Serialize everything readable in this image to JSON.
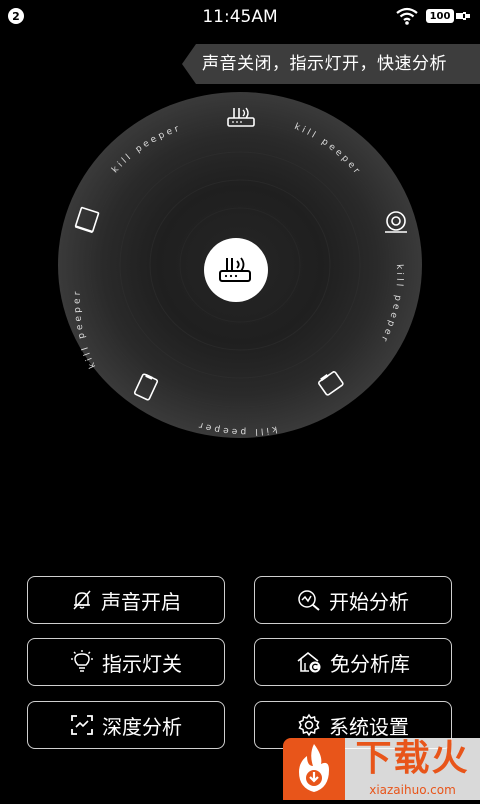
{
  "status_bar": {
    "notification_count": "2",
    "time": "11:45AM",
    "battery": "100",
    "icons": [
      "wifi-icon",
      "battery-icon",
      "charging-icon"
    ]
  },
  "banner": {
    "text": "声音关闭，指示灯开，快速分析"
  },
  "dial": {
    "ring_label": "kill peeper",
    "center_icon": "router-icon",
    "device_icons": [
      "router-icon",
      "camera-icon",
      "tablet-icon",
      "phone-icon",
      "tv-icon"
    ]
  },
  "buttons": {
    "sound": {
      "label": "声音开启",
      "icon": "bell-off-icon"
    },
    "analyze": {
      "label": "开始分析",
      "icon": "search-chart-icon"
    },
    "indicator": {
      "label": "指示灯关",
      "icon": "bulb-icon"
    },
    "library": {
      "label": "免分析库",
      "icon": "home-library-icon"
    },
    "deep": {
      "label": "深度分析",
      "icon": "scan-icon"
    },
    "settings": {
      "label": "系统设置",
      "icon": "gear-icon"
    }
  },
  "watermark": {
    "brand": "下载火",
    "url": "xiazaihuo.com"
  }
}
